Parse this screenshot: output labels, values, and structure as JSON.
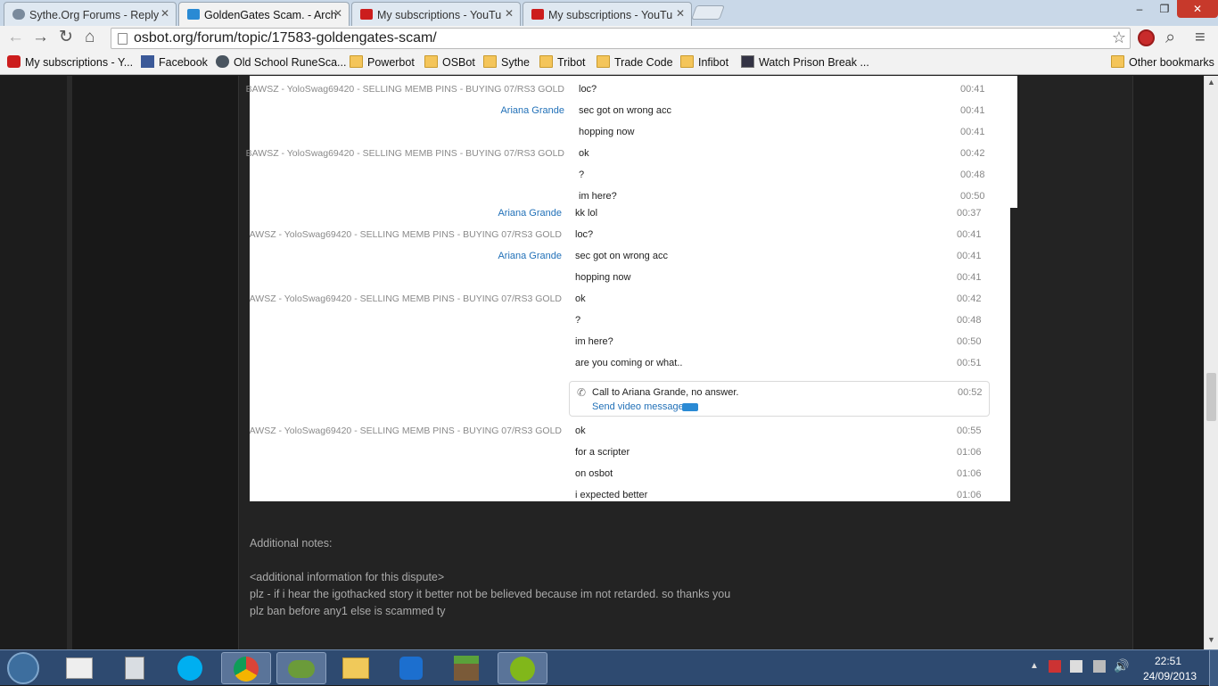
{
  "tabs": [
    {
      "title": "Sythe.Org Forums - Reply",
      "icon": "shield-icon",
      "color": "#7a8a9c"
    },
    {
      "title": "GoldenGates Scam. - Arch",
      "icon": "osbot-icon",
      "color": "#2a8ad4"
    },
    {
      "title": "My subscriptions - YouTu",
      "icon": "youtube-icon",
      "color": "#cc1d1d"
    },
    {
      "title": "My subscriptions - YouTu",
      "icon": "youtube-icon",
      "color": "#cc1d1d"
    }
  ],
  "window": {
    "minimize": "–",
    "restore": "❐",
    "close": "✕"
  },
  "toolbar": {
    "url": "osbot.org/forum/topic/17583-goldengates-scam/",
    "back": "←",
    "forward": "→",
    "reload": "↻",
    "home": "⌂",
    "star": "☆",
    "search": "⌕",
    "menu": "≡"
  },
  "bookmarks": [
    {
      "label": "My subscriptions - Y...",
      "icon": "youtube-icon"
    },
    {
      "label": "Facebook",
      "icon": "facebook-icon"
    },
    {
      "label": "Old School RuneSca...",
      "icon": "runescape-icon"
    },
    {
      "label": "Powerbot",
      "icon": "folder-icon"
    },
    {
      "label": "OSBot",
      "icon": "folder-icon"
    },
    {
      "label": "Sythe",
      "icon": "folder-icon"
    },
    {
      "label": "Tribot",
      "icon": "folder-icon"
    },
    {
      "label": "Trade Code",
      "icon": "folder-icon"
    },
    {
      "label": "Infibot",
      "icon": "folder-icon"
    },
    {
      "label": "Watch Prison Break ...",
      "icon": "film-icon"
    }
  ],
  "other_bookmarks": "Other bookmarks",
  "chat_overlay": [
    {
      "who": "BAWSZ - YoloSwag69420 - SELLING MEMB PINS - BUYING 07/RS3 GOLD",
      "ag": false,
      "msg": "loc?",
      "time": "00:41"
    },
    {
      "who": "Ariana Grande",
      "ag": true,
      "msg": "sec got on wrong acc",
      "time": "00:41"
    },
    {
      "who": "",
      "ag": false,
      "msg": "hopping now",
      "time": "00:41"
    },
    {
      "who": "BAWSZ - YoloSwag69420 - SELLING MEMB PINS - BUYING 07/RS3 GOLD",
      "ag": false,
      "msg": "ok",
      "time": "00:42"
    },
    {
      "who": "",
      "ag": false,
      "msg": "?",
      "time": "00:48"
    },
    {
      "who": "",
      "ag": false,
      "msg": "im here?",
      "time": "00:50"
    }
  ],
  "chat_main": [
    {
      "who": "Ariana Grande",
      "ag": true,
      "msg": "kk lol",
      "time": "00:37"
    },
    {
      "who": "BAWSZ - YoloSwag69420 - SELLING MEMB PINS - BUYING 07/RS3 GOLD",
      "ag": false,
      "msg": "loc?",
      "time": "00:41"
    },
    {
      "who": "Ariana Grande",
      "ag": true,
      "msg": "sec got on wrong acc",
      "time": "00:41"
    },
    {
      "who": "",
      "ag": false,
      "msg": "hopping now",
      "time": "00:41"
    },
    {
      "who": "BAWSZ - YoloSwag69420 - SELLING MEMB PINS - BUYING 07/RS3 GOLD",
      "ag": false,
      "msg": "ok",
      "time": "00:42"
    },
    {
      "who": "",
      "ag": false,
      "msg": "?",
      "time": "00:48"
    },
    {
      "who": "",
      "ag": false,
      "msg": "im here?",
      "time": "00:50"
    },
    {
      "who": "",
      "ag": false,
      "msg": "are you coming or what..",
      "time": "00:51"
    }
  ],
  "call": {
    "text": "Call to Ariana Grande, no answer.",
    "link": "Send video message",
    "time": "00:52"
  },
  "chat_after": [
    {
      "who": "BAWSZ - YoloSwag69420 - SELLING MEMB PINS - BUYING 07/RS3 GOLD",
      "ag": false,
      "msg": "ok",
      "time": "00:55"
    },
    {
      "who": "",
      "ag": false,
      "msg": "for a scripter",
      "time": "01:06"
    },
    {
      "who": "",
      "ag": false,
      "msg": "on osbot",
      "time": "01:06"
    },
    {
      "who": "",
      "ag": false,
      "msg": "i expected better",
      "time": "01:06"
    }
  ],
  "notes": {
    "heading": "Additional notes:",
    "placeholder": "<additional information for this dispute>",
    "line1": "plz - if i hear the igothacked story it better not be believed because im not retarded. so thanks you",
    "line2": "plz ban before any1 else is scammed ty"
  },
  "taskbar": {
    "apps": [
      "start-orb-icon",
      "paint-icon",
      "calculator-icon",
      "skype-icon",
      "chrome-icon",
      "people-icon",
      "explorer-icon",
      "teamviewer-icon",
      "minecraft-icon",
      "spotify-icon"
    ],
    "time": "22:51",
    "date": "24/09/2013"
  }
}
